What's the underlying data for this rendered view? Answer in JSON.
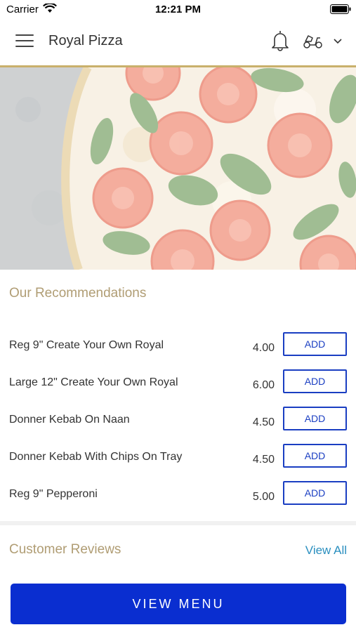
{
  "status_bar": {
    "carrier": "Carrier",
    "time": "12:21 PM"
  },
  "header": {
    "title": "Royal Pizza"
  },
  "recommendations": {
    "title": "Our Recommendations",
    "add_label": "ADD",
    "items": [
      {
        "name": "Reg 9\" Create Your Own Royal",
        "price": "4.00"
      },
      {
        "name": "Large 12\" Create Your Own Royal",
        "price": "6.00"
      },
      {
        "name": "Donner Kebab On Naan",
        "price": "4.50"
      },
      {
        "name": "Donner Kebab With Chips On Tray",
        "price": "4.50"
      },
      {
        "name": "Reg 9\" Pepperoni",
        "price": "5.00"
      }
    ]
  },
  "reviews": {
    "title": "Customer Reviews",
    "view_all": "View All"
  },
  "footer": {
    "view_menu": "VIEW MENU"
  },
  "colors": {
    "accent_blue": "#0a2ed0",
    "gold": "#b09d74",
    "link": "#2a8fbf"
  }
}
